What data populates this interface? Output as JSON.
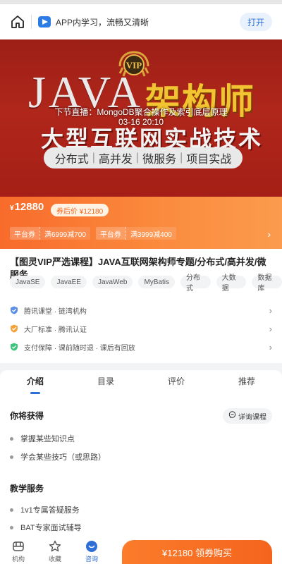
{
  "topbar": {
    "title": "APP内学习，流畅又清晰",
    "open_label": "打开",
    "home_icon": "home-icon",
    "logo_icon": "play-logo-icon"
  },
  "banner": {
    "vip_text": "VIP",
    "java_text": "JAVA",
    "arch_text": "架构师",
    "subtitle": "大型互联网实战技术",
    "tags": [
      "分布式",
      "高并发",
      "微服务",
      "项目实战"
    ],
    "live_title": "下节直播：MongoDB聚合操作及索引底层原理",
    "live_time": "03-16 20:10"
  },
  "pricing": {
    "currency": "¥",
    "price": "12880",
    "coupon_price": "券后价 ¥12180",
    "coupons": [
      {
        "type": "平台券",
        "value": "满6999减700"
      },
      {
        "type": "平台券",
        "value": "满3999减400"
      }
    ],
    "accent": "#f86b2b"
  },
  "course": {
    "title": "【图灵VIP严选课程】JAVA互联网架构师专题/分布式/高并发/微服务",
    "tags": [
      "JavaSE",
      "JavaEE",
      "JavaWeb",
      "MyBatis",
      "分布式",
      "大数据",
      "数据库"
    ],
    "features": [
      {
        "icon": "shield-icon",
        "text": "腾讯课堂 · 链湾机构",
        "color": "#5b8ee6"
      },
      {
        "icon": "check-badge-icon",
        "text": "大厂标准 · 腾讯认证",
        "color": "#f3a33a"
      },
      {
        "icon": "pay-shield-icon",
        "text": "支付保障 · 课前随时退 · 课后有回放",
        "color": "#3cc47c"
      }
    ]
  },
  "detail": {
    "tabs": [
      "介绍",
      "目录",
      "评价",
      "推荐"
    ],
    "active_tab": 0,
    "gain_title": "你将获得",
    "consult_label": "详询课程",
    "gains": [
      "掌握某些知识点",
      "学会某些技巧（或思路）"
    ],
    "service_title": "教学服务",
    "services": [
      "1v1专属答疑服务",
      "BAT专家面试辅导"
    ]
  },
  "bottom_nav": {
    "items": [
      {
        "label": "机构",
        "icon": "institution-icon"
      },
      {
        "label": "收藏",
        "icon": "star-icon"
      },
      {
        "label": "咨询",
        "icon": "chat-icon"
      }
    ],
    "buy_label": "¥12180 领券购买",
    "brand_color": "#2d6fd6"
  }
}
